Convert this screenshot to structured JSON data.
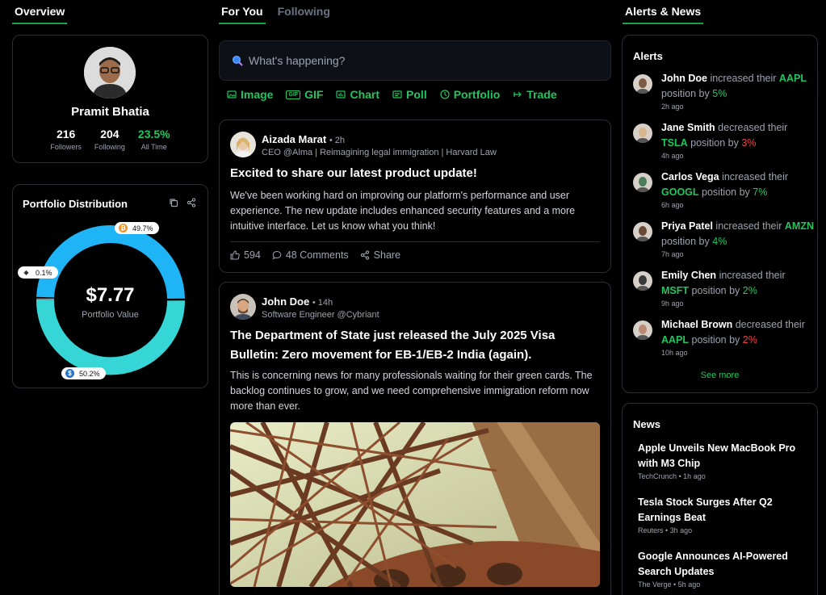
{
  "left_header": "Overview",
  "feed_tabs": [
    "For You",
    "Following"
  ],
  "right_header": "Alerts & News",
  "profile": {
    "name": "Pramit Bhatia",
    "stats": [
      {
        "value": "216",
        "label": "Followers"
      },
      {
        "value": "204",
        "label": "Following"
      },
      {
        "value": "23.5%",
        "label": "All Time"
      }
    ]
  },
  "portfolio": {
    "title": "Portfolio Distribution",
    "value": "$7.77",
    "value_label": "Portfolio Value",
    "slices": [
      {
        "label": "49.7%",
        "coin": "bitcoin-icon",
        "color": "#1fb4f5"
      },
      {
        "label": "0.1%",
        "coin": "ethereum-icon",
        "color": "#e5e7eb"
      },
      {
        "label": "50.2%",
        "coin": "usdc-icon",
        "color": "#36d6d6"
      }
    ]
  },
  "composer": {
    "placeholder": "What's happening?",
    "actions": [
      "Image",
      "GIF",
      "Chart",
      "Poll",
      "Portfolio",
      "Trade"
    ]
  },
  "posts": [
    {
      "author": "Aizada Marat",
      "time": "• 2h",
      "role": "CEO @Alma | Reimagining legal immigration | Harvard Law",
      "title": "Excited to share our latest product update!",
      "body": "We've been working hard on improving our platform's performance and user experience. The new update includes enhanced security features and a more intuitive interface. Let us know what you think!",
      "likes": "594",
      "comments": "48 Comments",
      "share": "Share"
    },
    {
      "author": "John Doe",
      "time": "• 14h",
      "role": "Software Engineer @Cybriant",
      "title": "The Department of State just released the July 2025 Visa Bulletin: Zero movement for EB-1/EB-2 India (again).",
      "body": "This is concerning news for many professionals waiting for their green cards. The backlog continues to grow, and we need comprehensive immigration reform now more than ever."
    }
  ],
  "alerts": {
    "title": "Alerts",
    "items": [
      {
        "name": "John Doe",
        "action": "increased their",
        "ticker": "AAPL",
        "mid": "position by",
        "pct": "5%",
        "dir": "up",
        "ago": "2h ago",
        "av": "#7c5a43"
      },
      {
        "name": "Jane Smith",
        "action": "decreased their",
        "ticker": "TSLA",
        "mid": "position by",
        "pct": "3%",
        "dir": "dn",
        "ago": "4h ago",
        "av": "#d8b58a"
      },
      {
        "name": "Carlos Vega",
        "action": "increased their",
        "ticker": "GOOGL",
        "mid": "position by",
        "pct": "7%",
        "dir": "up",
        "ago": "6h ago",
        "av": "#4a7c59"
      },
      {
        "name": "Priya Patel",
        "action": "increased their",
        "ticker": "AMZN",
        "mid": "position by",
        "pct": "4%",
        "dir": "up",
        "ago": "7h ago",
        "av": "#6b4a35"
      },
      {
        "name": "Emily Chen",
        "action": "increased their",
        "ticker": "MSFT",
        "mid": "position by",
        "pct": "2%",
        "dir": "up",
        "ago": "9h ago",
        "av": "#3a3a3a"
      },
      {
        "name": "Michael Brown",
        "action": "decreased their",
        "ticker": "AAPL",
        "mid": "position by",
        "pct": "2%",
        "dir": "dn",
        "ago": "10h ago",
        "av": "#b98b72"
      }
    ],
    "see_more": "See more"
  },
  "news": {
    "title": "News",
    "items": [
      {
        "title": "Apple Unveils New MacBook Pro with M3 Chip",
        "source": "TechCrunch • 1h ago"
      },
      {
        "title": "Tesla Stock Surges After Q2 Earnings Beat",
        "source": "Reuters • 3h ago"
      },
      {
        "title": "Google Announces AI-Powered Search Updates",
        "source": "The Verge • 5h ago"
      }
    ]
  }
}
